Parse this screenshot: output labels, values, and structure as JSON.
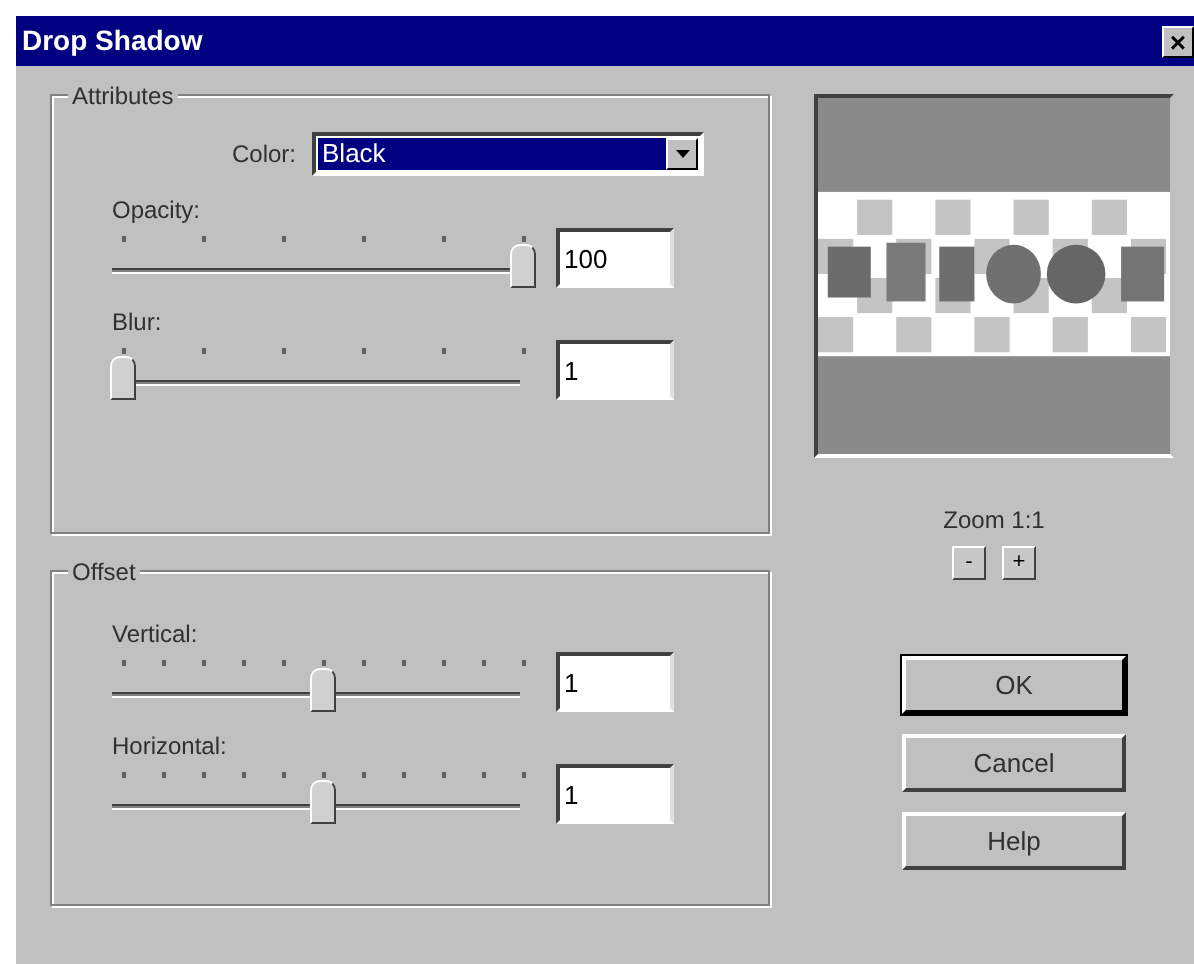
{
  "window": {
    "title": "Drop Shadow",
    "close": "×"
  },
  "attributes": {
    "legend": "Attributes",
    "color": {
      "label": "Color:",
      "value": "Black"
    },
    "sliders": [
      {
        "label": "Opacity:",
        "kind": "coarse",
        "level": 1,
        "value": "100"
      },
      {
        "label": "Blur:",
        "kind": "coarse",
        "level": 0,
        "value": "1"
      }
    ]
  },
  "offset": {
    "legend": "Offset",
    "sliders": [
      {
        "label": "Vertical:",
        "kind": "fine",
        "level": 0.5,
        "value": "1"
      },
      {
        "label": "Horizontal:",
        "kind": "fine",
        "level": 0.5,
        "value": "1"
      }
    ]
  },
  "preview": {
    "zoom_label": "Zoom 1:1",
    "zoom_buttons": [
      "-",
      "+"
    ]
  },
  "buttons": [
    {
      "label": "OK",
      "default": true
    },
    {
      "label": "Cancel",
      "default": false
    },
    {
      "label": "Help",
      "default": false
    }
  ]
}
